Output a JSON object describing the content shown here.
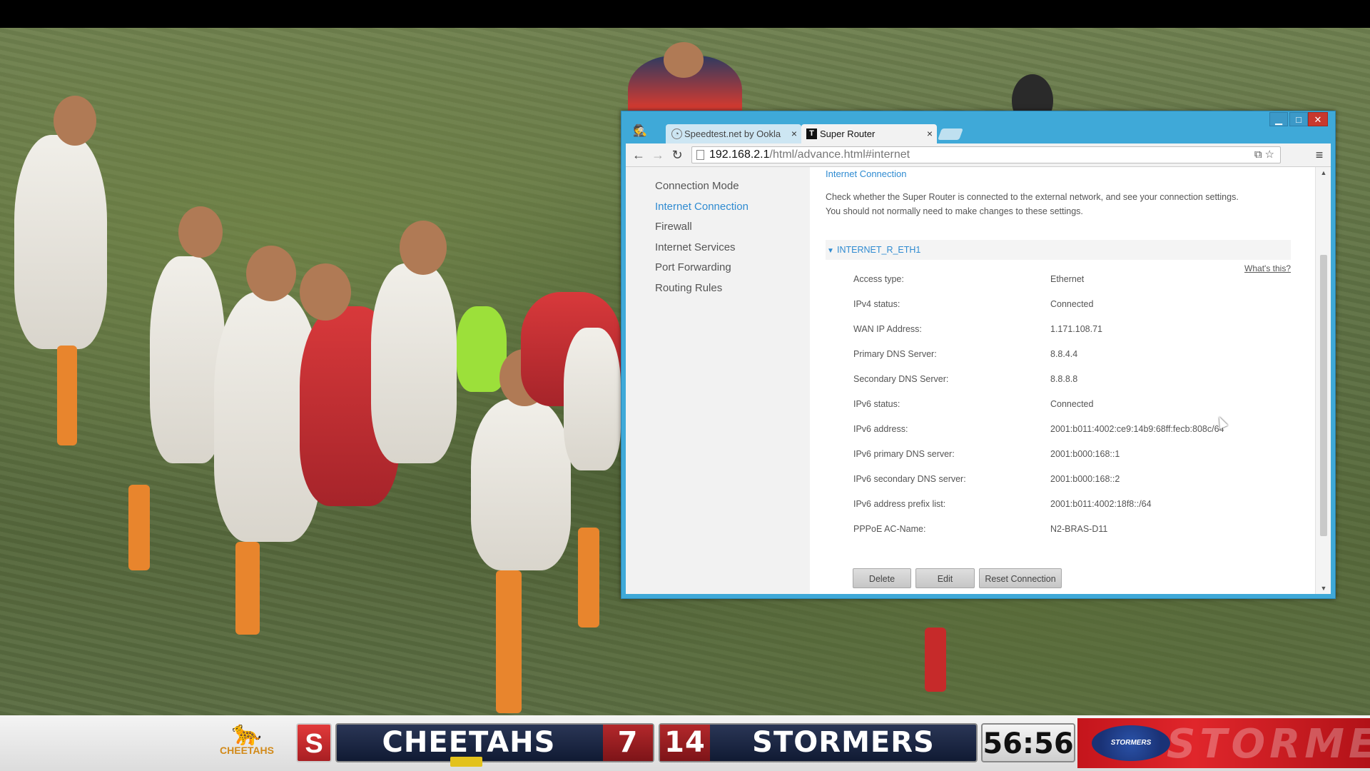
{
  "browser": {
    "tabs": [
      {
        "label": "Speedtest.net by Ookla",
        "icon": "speedometer-icon",
        "active": false
      },
      {
        "label": "Super Router",
        "icon": "router-favicon",
        "active": true
      }
    ],
    "active_tab_favicon": "T",
    "url_host": "192.168.2.1",
    "url_path": "/html/advance.html#internet",
    "window_controls": {
      "minimize": "▁",
      "maximize": "□",
      "close": "✕"
    },
    "nav": {
      "back": "←",
      "forward": "→",
      "reload": "↻",
      "menu": "≡"
    },
    "tab_close": "×"
  },
  "sidebar": {
    "items": [
      {
        "label": "Connection Mode",
        "active": false
      },
      {
        "label": "Internet Connection",
        "active": true
      },
      {
        "label": "Firewall",
        "active": false
      },
      {
        "label": "Internet Services",
        "active": false
      },
      {
        "label": "Port Forwarding",
        "active": false
      },
      {
        "label": "Routing Rules",
        "active": false
      }
    ]
  },
  "content": {
    "title": "Internet Connection",
    "intro_line1": "Check whether the Super Router is connected to the external network, and see your connection settings.",
    "intro_line2": "You should not normally need to make changes to these settings.",
    "group_name": "INTERNET_R_ETH1",
    "whats_this": "What's this?",
    "rows": [
      {
        "label": "Access type:",
        "value": "Ethernet"
      },
      {
        "label": "IPv4 status:",
        "value": "Connected"
      },
      {
        "label": "WAN IP Address:",
        "value": "1.171.108.71"
      },
      {
        "label": "Primary DNS Server:",
        "value": "8.8.4.4"
      },
      {
        "label": "Secondary DNS Server:",
        "value": "8.8.8.8"
      },
      {
        "label": "IPv6 status:",
        "value": "Connected"
      },
      {
        "label": "IPv6 address:",
        "value": "2001:b011:4002:ce9:14b9:68ff:fecb:808c/64"
      },
      {
        "label": "IPv6 primary DNS server:",
        "value": "2001:b000:168::1"
      },
      {
        "label": "IPv6 secondary DNS server:",
        "value": "2001:b000:168::2"
      },
      {
        "label": "IPv6 address prefix list:",
        "value": "2001:b011:4002:18f8::/64"
      },
      {
        "label": "PPPoE AC-Name:",
        "value": "N2-BRAS-D11"
      }
    ],
    "buttons": {
      "delete": "Delete",
      "edit": "Edit",
      "reset": "Reset Connection"
    }
  },
  "scoreboard": {
    "home_team": "CHEETAHS",
    "home_score": "7",
    "away_score": "14",
    "away_team": "STORMERS",
    "clock": "56:56",
    "home_logo_text": "CHEETAHS",
    "away_logo_text": "STORMERS",
    "banner_text": "STORMERS",
    "sponsor_logo": "S"
  },
  "colors": {
    "accent": "#2f8bd1",
    "window_frame": "#3fa9d8",
    "close_button": "#c8382e",
    "home_score_bg": "#b3282b"
  }
}
